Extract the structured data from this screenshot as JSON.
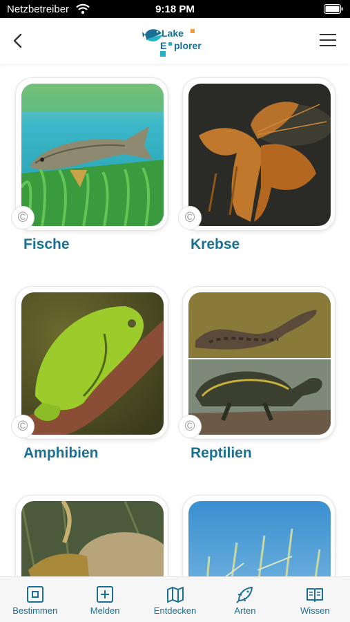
{
  "status_bar": {
    "carrier": "Netzbetreiber",
    "time": "9:18 PM"
  },
  "header": {
    "logo_line1": "Lake",
    "logo_line2_a": "E",
    "logo_line2_b": "plorer",
    "back_icon": "chevron-left-icon",
    "menu_icon": "hamburger-menu-icon"
  },
  "categories": [
    {
      "label": "Fische"
    },
    {
      "label": "Krebse"
    },
    {
      "label": "Amphibien"
    },
    {
      "label": "Reptilien"
    },
    {
      "label": ""
    },
    {
      "label": ""
    }
  ],
  "tabs": [
    {
      "label": "Bestimmen",
      "icon": "identify-icon"
    },
    {
      "label": "Melden",
      "icon": "plus-square-icon"
    },
    {
      "label": "Entdecken",
      "icon": "map-icon"
    },
    {
      "label": "Arten",
      "icon": "species-fish-icon"
    },
    {
      "label": "Wissen",
      "icon": "book-icon"
    }
  ],
  "colors": {
    "accent": "#1a6f94",
    "logo_orange": "#f19a3e",
    "logo_teal": "#23b2c6"
  }
}
